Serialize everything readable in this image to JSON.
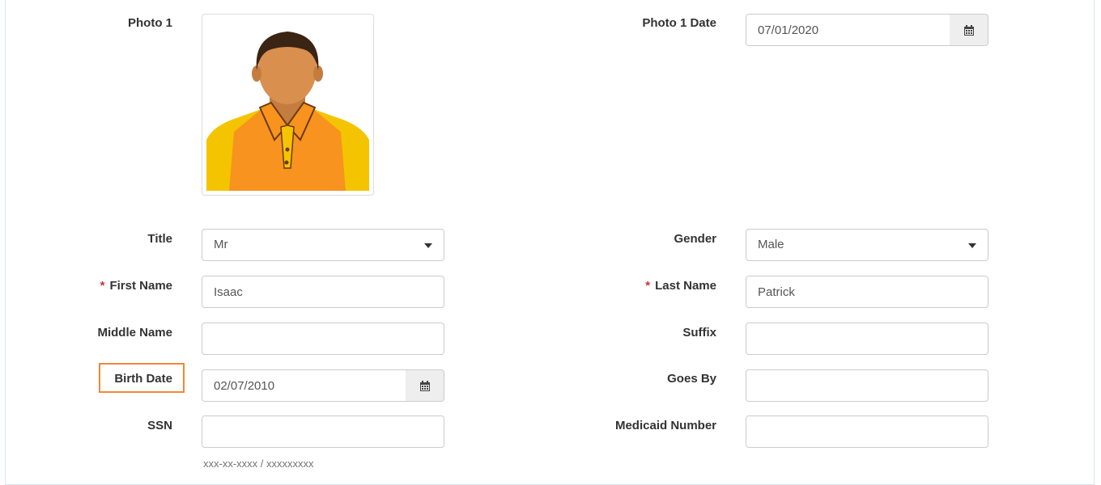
{
  "form": {
    "photo1_label": "Photo 1",
    "photo1_date_label": "Photo 1 Date",
    "photo1_date_value": "07/01/2020",
    "title_label": "Title",
    "title_value": "Mr",
    "gender_label": "Gender",
    "gender_value": "Male",
    "first_name_label": "First Name",
    "first_name_value": "Isaac",
    "last_name_label": "Last Name",
    "last_name_value": "Patrick",
    "required_marker": "*",
    "middle_name_label": "Middle Name",
    "middle_name_value": "",
    "suffix_label": "Suffix",
    "suffix_value": "",
    "birth_date_label": "Birth Date",
    "birth_date_value": "02/07/2010",
    "goes_by_label": "Goes By",
    "goes_by_value": "",
    "ssn_label": "SSN",
    "ssn_value": "",
    "ssn_hint": "xxx-xx-xxxx / xxxxxxxxx",
    "medicaid_label": "Medicaid Number",
    "medicaid_value": ""
  },
  "colors": {
    "highlight": "#f0883a",
    "required": "#c9302c",
    "shirt": "#f7931e",
    "skin": "#d98f4e"
  },
  "icons": {
    "calendar": "calendar-icon",
    "caret": "chevron-down-icon",
    "avatar": "person-avatar-icon"
  }
}
